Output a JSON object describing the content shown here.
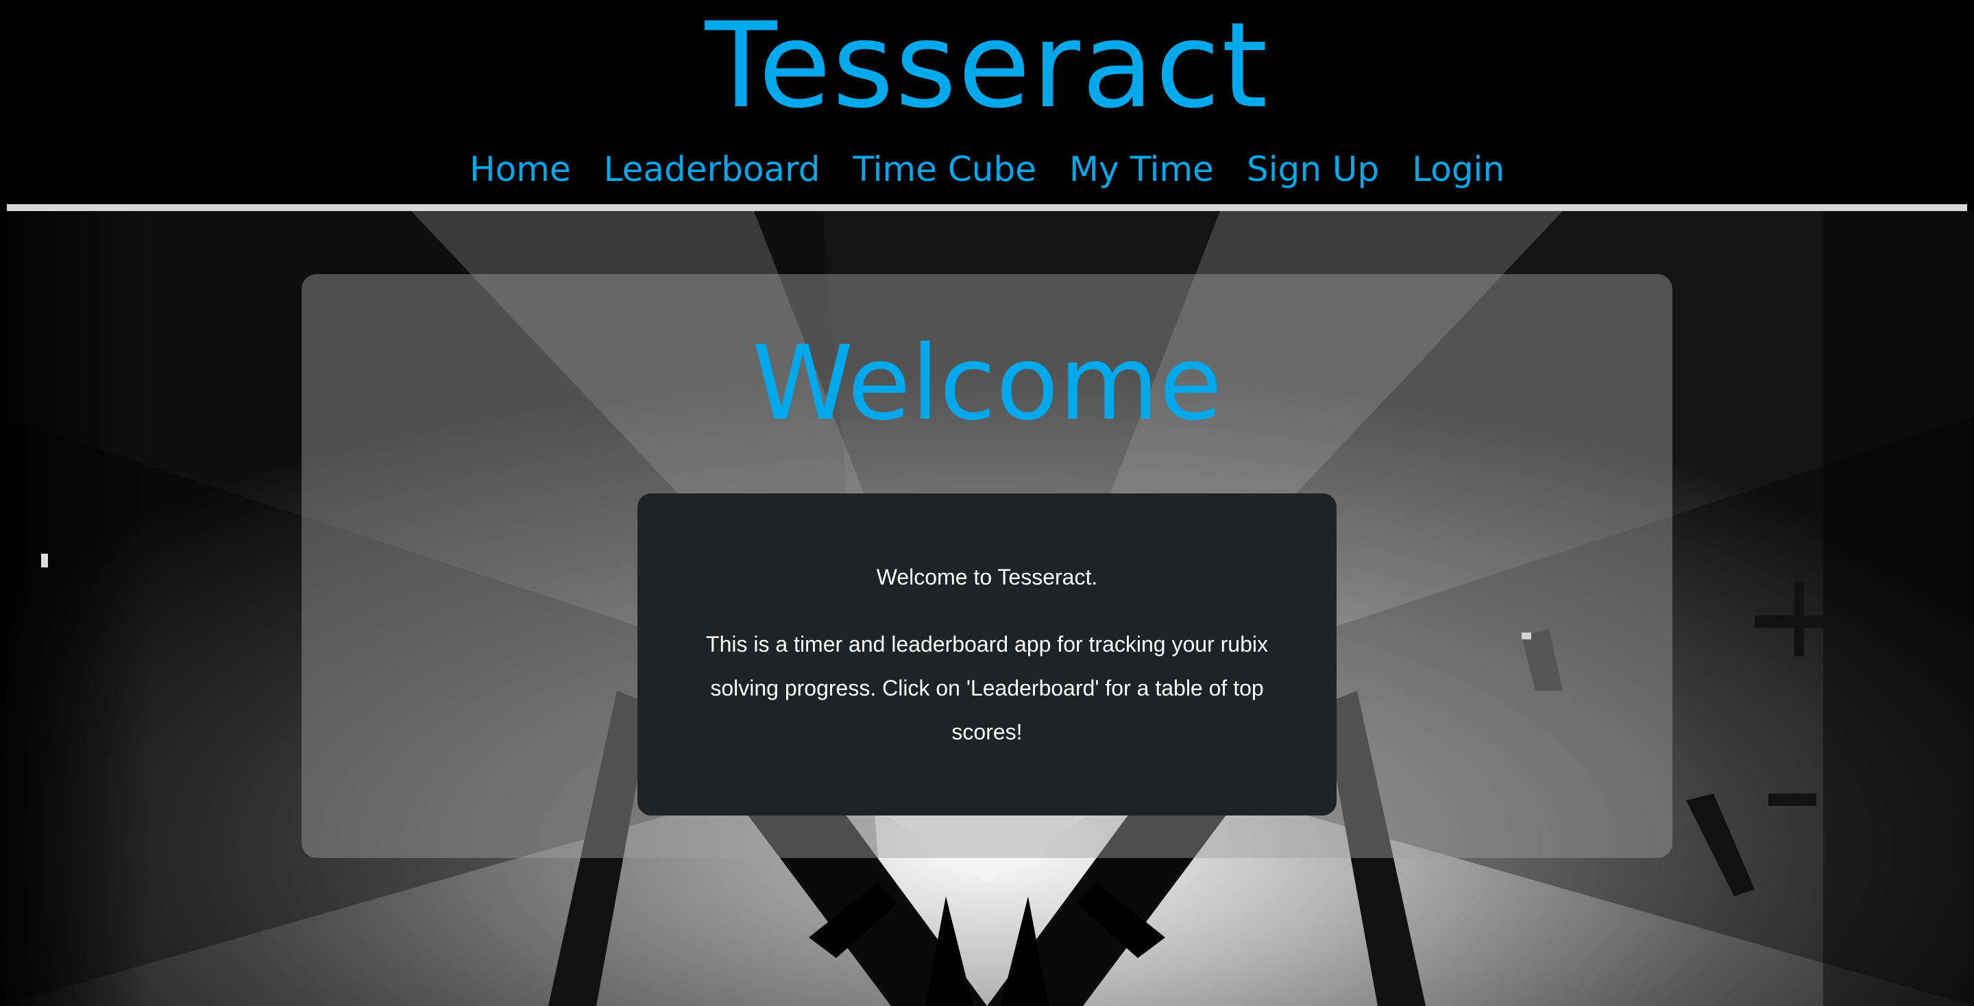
{
  "header": {
    "title": "Tesseract",
    "nav": [
      "Home",
      "Leaderboard",
      "Time Cube",
      "My Time",
      "Sign Up",
      "Login"
    ]
  },
  "main": {
    "heading": "Welcome",
    "intro_line": "Welcome to Tesseract.",
    "intro_paragraph": "This is a timer and leaderboard app for tracking your rubix solving progress. Click on 'Leaderboard' for a table of top scores!"
  },
  "colors": {
    "accent": "#00a8ec",
    "background": "#000000",
    "card": "#212223",
    "divider": "#d8d8d8"
  }
}
